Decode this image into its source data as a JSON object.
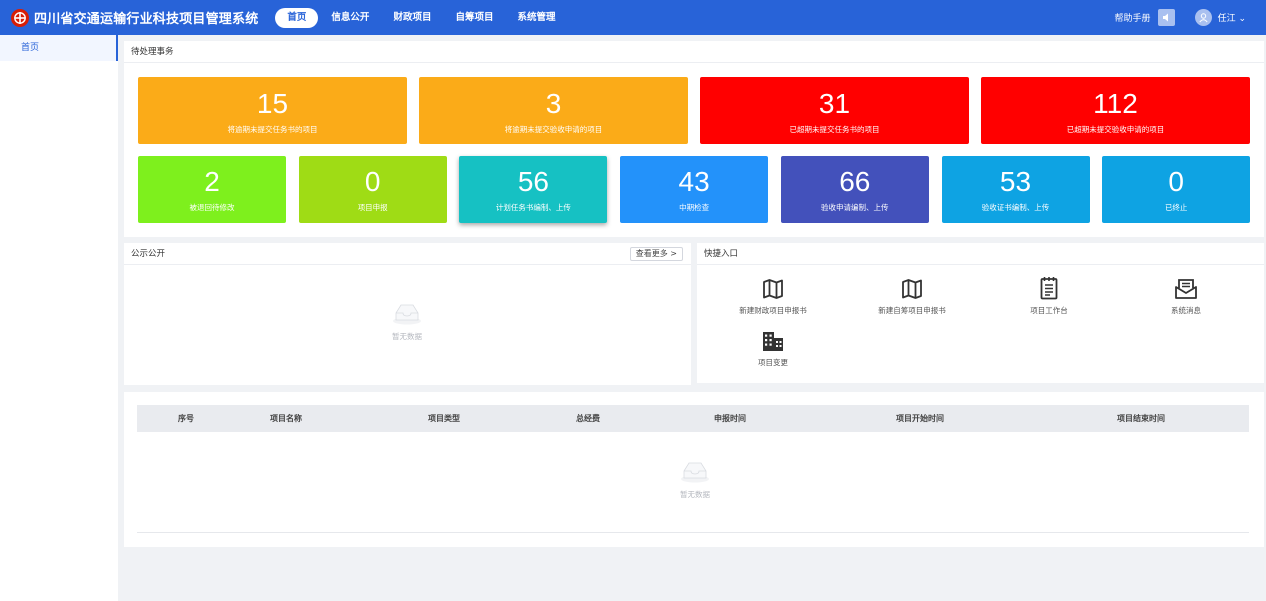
{
  "header": {
    "title": "四川省交通运输行业科技项目管理系统",
    "nav": [
      "首页",
      "信息公开",
      "财政项目",
      "自筹项目",
      "系统管理"
    ],
    "help": "帮助手册",
    "user": "任江",
    "user_caret": "⌄"
  },
  "sidebar": {
    "items": [
      {
        "label": "首页"
      }
    ]
  },
  "pending": {
    "title": "待处理事务",
    "big": [
      {
        "value": "15",
        "label": "将逾期未提交任务书的项目",
        "color": "#fbab18"
      },
      {
        "value": "3",
        "label": "将逾期未提交验收申请的项目",
        "color": "#fbab18"
      },
      {
        "value": "31",
        "label": "已超期未提交任务书的项目",
        "color": "#ff0000"
      },
      {
        "value": "112",
        "label": "已超期未提交验收申请的项目",
        "color": "#ff0000"
      }
    ],
    "small": [
      {
        "value": "2",
        "label": "被退回待修改",
        "color": "#7ef01d"
      },
      {
        "value": "0",
        "label": "项目申报",
        "color": "#9fdc15"
      },
      {
        "value": "56",
        "label": "计划任务书编制、上传",
        "color": "#16c1c3"
      },
      {
        "value": "43",
        "label": "中期检查",
        "color": "#2392fa"
      },
      {
        "value": "66",
        "label": "验收申请编制、上传",
        "color": "#4351bb"
      },
      {
        "value": "53",
        "label": "验收证书编制、上传",
        "color": "#0ea3e3"
      },
      {
        "value": "0",
        "label": "已终止",
        "color": "#0ea3e3"
      }
    ]
  },
  "notice": {
    "title": "公示公开",
    "more": "查看更多",
    "more_icon": ">",
    "empty": "暂无数据"
  },
  "quick": {
    "title": "快捷入口",
    "items": [
      {
        "label": "新建财政项目申报书",
        "icon": "map-icon"
      },
      {
        "label": "新建自筹项目申报书",
        "icon": "map-icon"
      },
      {
        "label": "项目工作台",
        "icon": "notepad-icon"
      },
      {
        "label": "系统消息",
        "icon": "mail-icon"
      },
      {
        "label": "项目变更",
        "icon": "building-icon"
      }
    ]
  },
  "table": {
    "columns": [
      "序号",
      "项目名称",
      "项目类型",
      "总经费",
      "申报时间",
      "项目开始时间",
      "项目结束时间"
    ],
    "empty": "暂无数据"
  }
}
